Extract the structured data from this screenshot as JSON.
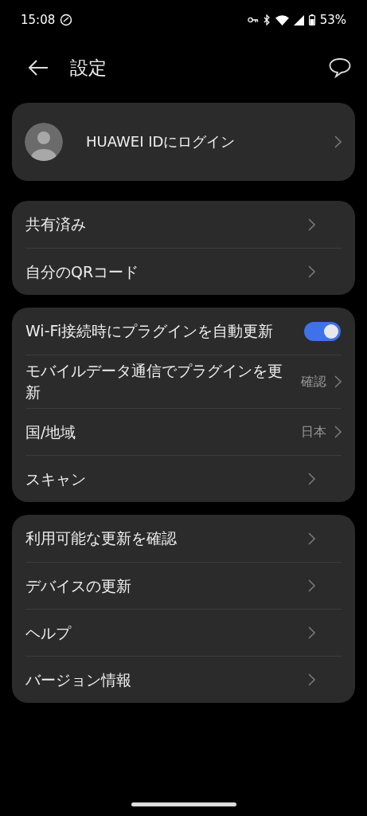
{
  "status_bar": {
    "time": "15:08",
    "battery": "53%"
  },
  "header": {
    "title": "設定"
  },
  "account": {
    "label": "HUAWEI IDにログイン"
  },
  "groups": [
    {
      "items": [
        {
          "kind": "link",
          "label": "共有済み"
        },
        {
          "kind": "link",
          "label": "自分のQRコード"
        }
      ]
    },
    {
      "items": [
        {
          "kind": "toggle",
          "label": "Wi-Fi接続時にプラグインを自動更新",
          "on": true
        },
        {
          "kind": "link",
          "label": "モバイルデータ通信でプラグインを更新",
          "value": "確認"
        },
        {
          "kind": "link",
          "label": "国/地域",
          "value": "日本"
        },
        {
          "kind": "link",
          "label": "スキャン"
        }
      ]
    },
    {
      "items": [
        {
          "kind": "link",
          "label": "利用可能な更新を確認"
        },
        {
          "kind": "link",
          "label": "デバイスの更新"
        },
        {
          "kind": "link",
          "label": "ヘルプ"
        },
        {
          "kind": "link",
          "label": "バージョン情報"
        }
      ]
    }
  ]
}
